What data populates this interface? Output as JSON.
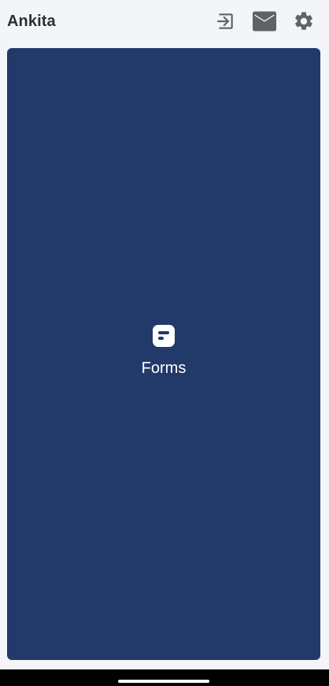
{
  "header": {
    "user_name": "Ankita",
    "icons": {
      "logout": "logout-icon",
      "mail": "mail-icon",
      "settings": "gear-icon"
    },
    "icon_color": "#5f6368"
  },
  "main": {
    "tile": {
      "label": "Forms",
      "icon": "forms-icon",
      "background": "#223a6a"
    }
  },
  "colors": {
    "page_background": "#f3f5f8",
    "text_primary": "#2b2f36"
  }
}
